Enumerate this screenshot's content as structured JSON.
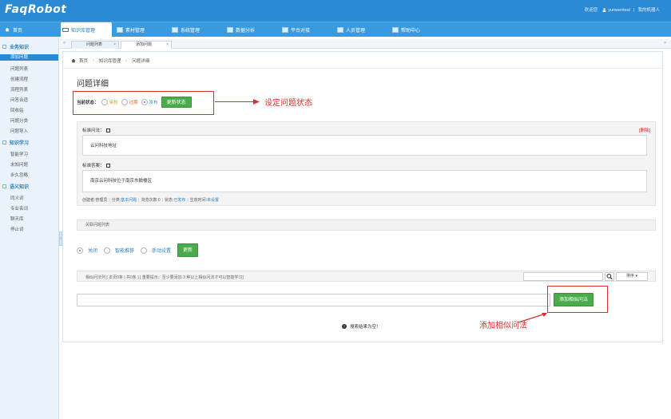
{
  "app": {
    "logo": "FaqRobot",
    "welcome": "欢迎您",
    "user": "yunwentest",
    "robot_link": "我的机器人",
    "top_sep": "|"
  },
  "nav": [
    {
      "label": "首页",
      "icon": "home-icon"
    },
    {
      "label": "知识库管理",
      "icon": "knowledge-icon",
      "active": true
    },
    {
      "label": "素材管理",
      "icon": "material-icon"
    },
    {
      "label": "系统管理",
      "icon": "system-icon"
    },
    {
      "label": "数据分析",
      "icon": "chart-icon"
    },
    {
      "label": "平台对接",
      "icon": "platform-icon"
    },
    {
      "label": "人员管理",
      "icon": "people-icon"
    },
    {
      "label": "帮助中心",
      "icon": "help-icon"
    }
  ],
  "sidebar": {
    "groups": [
      {
        "label": "业务知识",
        "items": [
          "添加问题",
          "问题列表",
          "创建流程",
          "流程列表",
          "问答合适",
          "回收站",
          "问题分类",
          "问题导入"
        ]
      },
      {
        "label": "知识学习",
        "items": [
          "智能学习",
          "未知问题",
          "永久忽略"
        ]
      },
      {
        "label": "语义知识",
        "items": [
          "同义词",
          "专业名词",
          "聊天库",
          "停止词"
        ]
      }
    ],
    "active_item": "添加问题"
  },
  "tabs": [
    {
      "label": "问题列表",
      "close": "×"
    },
    {
      "label": "添加问题",
      "close": "×",
      "active": true
    }
  ],
  "breadcrumb": [
    "首页",
    "知识库管理",
    "问题详细"
  ],
  "page": {
    "title": "问题详细",
    "status_label": "当前状态：",
    "status_options": [
      "审核",
      "过期",
      "发布"
    ],
    "status_selected": "发布",
    "update_status_button": "更新状态",
    "annotation_status": "设定问题状态",
    "std_question_label": "标准问法：",
    "delete_link": "[删除]",
    "std_question_value": "云问科技地址",
    "std_answer_label": "标准答案：",
    "std_answer_value": "南京云问科技位于南京市鼓楼区",
    "meta": {
      "creator_label": "创建者:",
      "creator": "管理员",
      "category_label": "分类:",
      "category": "基本问题",
      "views_label": "浏览次数:",
      "views": "0",
      "status_label": "状态:",
      "status": "已发布",
      "effective_label": "生效时间:",
      "effective": "未设置"
    },
    "related_list_label": "关联问题列表",
    "recommend_options": [
      "关闭",
      "智能推荐",
      "手动设置"
    ],
    "recommend_selected": "关闭",
    "update_button": "更新",
    "similar_list_text": "相似问法列 [ 本页0条 | 共0条 ]    [ 重要提示：至少要添加 3 种以上相似问法才可以智能学习]",
    "sort_label": "排序",
    "add_similar_button": "添加相似问法",
    "annotation_similar": "添加相似问法",
    "empty_text": "搜索结果为空！"
  },
  "colors": {
    "topbar": "#2a8ad4",
    "accent": "#2a7fc6",
    "green_button": "#4aab4a",
    "annotation_red": "#d83030"
  }
}
